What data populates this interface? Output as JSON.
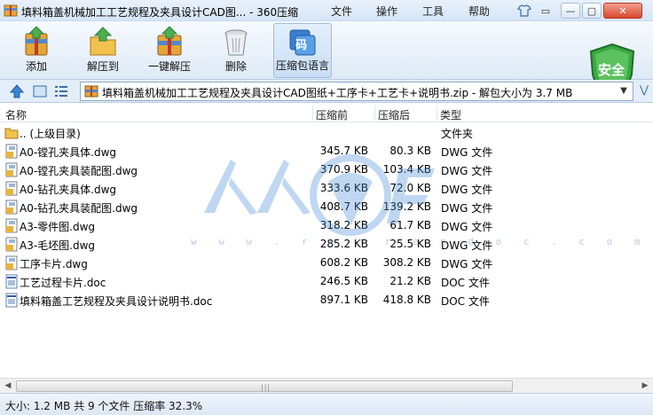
{
  "window": {
    "title": "填料箱盖机械加工工艺规程及夹具设计CAD图... - 360压缩",
    "menus": [
      "文件",
      "操作",
      "工具",
      "帮助"
    ]
  },
  "toolbar": {
    "buttons": [
      {
        "label": "添加",
        "icon": "add-archive-icon"
      },
      {
        "label": "解压到",
        "icon": "extract-to-icon"
      },
      {
        "label": "一键解压",
        "icon": "one-click-extract-icon"
      },
      {
        "label": "删除",
        "icon": "trash-icon"
      },
      {
        "label": "压缩包语言",
        "icon": "archive-language-icon",
        "icon_text": "码"
      }
    ],
    "security_badge": "安全"
  },
  "address": {
    "path": "填料箱盖机械加工工艺规程及夹具设计CAD图纸+工序卡+工艺卡+说明书.zip - 解包大小为 3.7 MB"
  },
  "columns": {
    "name": "名称",
    "compressed": "压缩前",
    "packed": "压缩后",
    "type": "类型"
  },
  "files": [
    {
      "name": ".. (上级目录)",
      "compressed": "",
      "packed": "",
      "type": "文件夹",
      "icon": "folder"
    },
    {
      "name": "A0-镗孔夹具体.dwg",
      "compressed": "345.7 KB",
      "packed": "80.3 KB",
      "type": "DWG 文件",
      "icon": "dwg"
    },
    {
      "name": "A0-镗孔夹具装配图.dwg",
      "compressed": "370.9 KB",
      "packed": "103.4 KB",
      "type": "DWG 文件",
      "icon": "dwg"
    },
    {
      "name": "A0-钻孔夹具体.dwg",
      "compressed": "333.6 KB",
      "packed": "72.0 KB",
      "type": "DWG 文件",
      "icon": "dwg"
    },
    {
      "name": "A0-钻孔夹具装配图.dwg",
      "compressed": "408.7 KB",
      "packed": "139.2 KB",
      "type": "DWG 文件",
      "icon": "dwg"
    },
    {
      "name": "A3-零件图.dwg",
      "compressed": "318.2 KB",
      "packed": "61.7 KB",
      "type": "DWG 文件",
      "icon": "dwg"
    },
    {
      "name": "A3-毛坯图.dwg",
      "compressed": "285.2 KB",
      "packed": "25.5 KB",
      "type": "DWG 文件",
      "icon": "dwg"
    },
    {
      "name": "工序卡片.dwg",
      "compressed": "608.2 KB",
      "packed": "308.2 KB",
      "type": "DWG 文件",
      "icon": "dwg"
    },
    {
      "name": "工艺过程卡片.doc",
      "compressed": "246.5 KB",
      "packed": "21.2 KB",
      "type": "DOC 文件",
      "icon": "doc"
    },
    {
      "name": "填料箱盖工艺规程及夹具设计说明书.doc",
      "compressed": "897.1 KB",
      "packed": "418.8 KB",
      "type": "DOC 文件",
      "icon": "doc"
    }
  ],
  "watermark": {
    "text": "w w w . r e n r e n d o c . c o m"
  },
  "status": {
    "text": "大小: 1.2 MB 共 9 个文件 压缩率 32.3%"
  }
}
